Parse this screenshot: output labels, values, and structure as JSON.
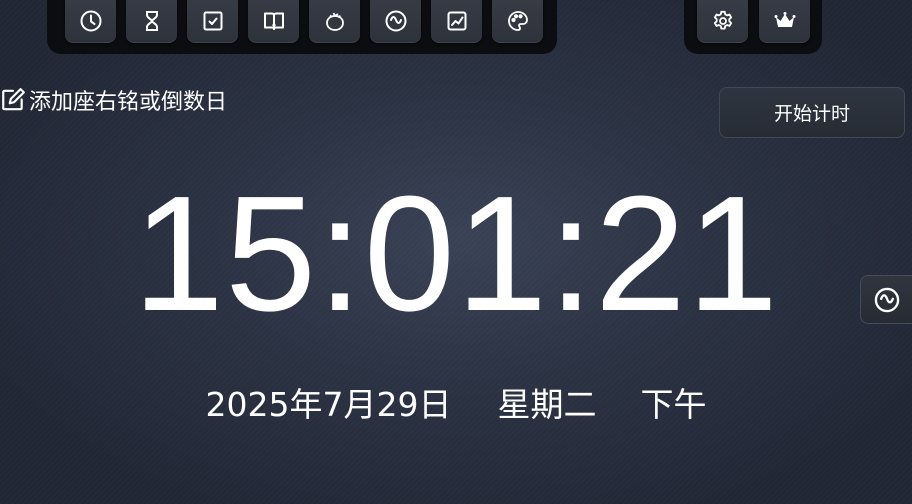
{
  "toolbar": {
    "left_icons": [
      "clock-icon",
      "hourglass-icon",
      "checkbox-icon",
      "notice-book-icon",
      "tomato-icon",
      "wave-circle-icon",
      "chart-icon",
      "palette-icon"
    ],
    "right_icons": [
      "gear-icon",
      "crown-icon"
    ]
  },
  "motto": {
    "label": "添加座右铭或倒数日",
    "icon": "edit-icon"
  },
  "start_button": {
    "label": "开始计时"
  },
  "clock": {
    "time": "15:01:21"
  },
  "date_line": {
    "date": "2025年7月29日",
    "weekday": "星期二",
    "period": "下午"
  },
  "side_button": {
    "icon": "wave-circle-icon"
  },
  "colors": {
    "background": "#2c3344",
    "toolbar": "#0c0d10",
    "button": "#30353f",
    "text": "#ffffff"
  }
}
